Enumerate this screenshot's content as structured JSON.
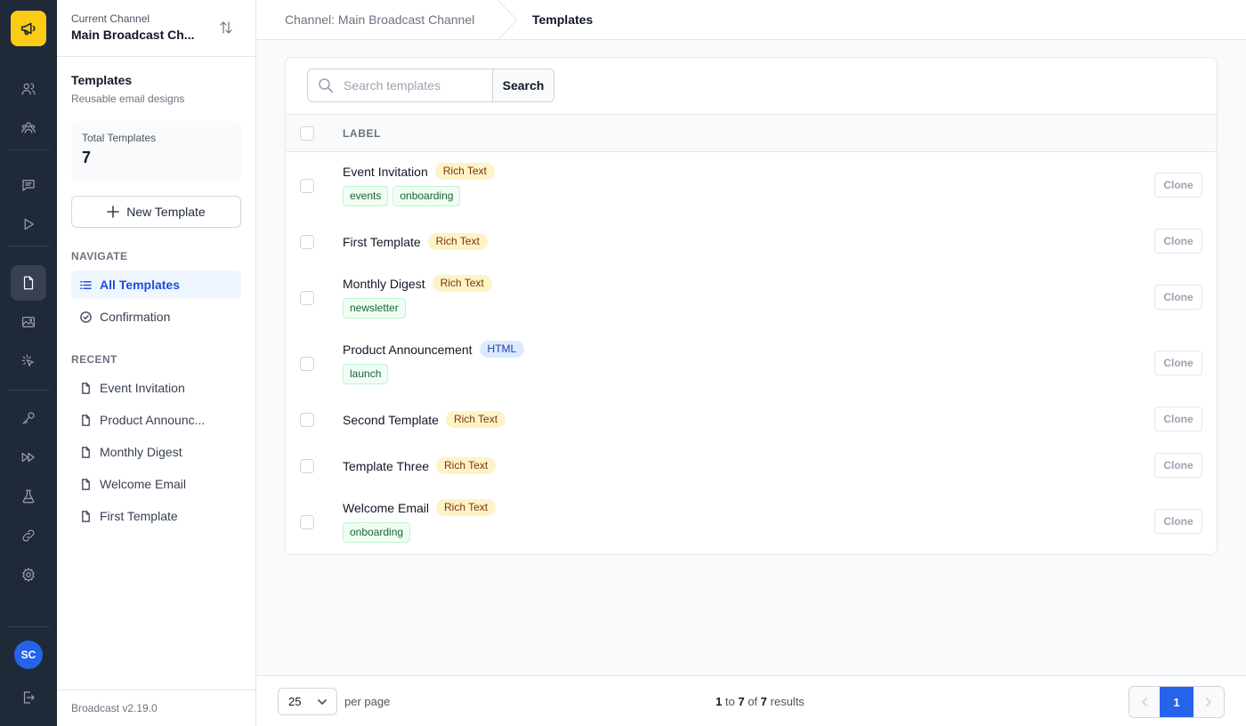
{
  "channel": {
    "label": "Current Channel",
    "name": "Main Broadcast Ch..."
  },
  "sidebar": {
    "title": "Templates",
    "subtitle": "Reusable email designs",
    "stat_label": "Total Templates",
    "stat_value": "7",
    "new_button": "New Template",
    "navigate_heading": "NAVIGATE",
    "nav_items": [
      {
        "label": "All Templates"
      },
      {
        "label": "Confirmation"
      }
    ],
    "recent_heading": "RECENT",
    "recent_items": [
      {
        "label": "Event Invitation"
      },
      {
        "label": "Product Announc..."
      },
      {
        "label": "Monthly Digest"
      },
      {
        "label": "Welcome Email"
      },
      {
        "label": "First Template"
      }
    ],
    "version": "Broadcast v2.19.0"
  },
  "user": {
    "initials": "SC"
  },
  "breadcrumb": {
    "parent": "Channel: Main Broadcast Channel",
    "current": "Templates"
  },
  "search": {
    "placeholder": "Search templates",
    "button": "Search"
  },
  "table": {
    "column_label": "LABEL",
    "clone_label": "Clone",
    "rows": [
      {
        "name": "Event Invitation",
        "type": "Rich Text",
        "tags": [
          "events",
          "onboarding"
        ]
      },
      {
        "name": "First Template",
        "type": "Rich Text",
        "tags": []
      },
      {
        "name": "Monthly Digest",
        "type": "Rich Text",
        "tags": [
          "newsletter"
        ]
      },
      {
        "name": "Product Announcement",
        "type": "HTML",
        "tags": [
          "launch"
        ]
      },
      {
        "name": "Second Template",
        "type": "Rich Text",
        "tags": []
      },
      {
        "name": "Template Three",
        "type": "Rich Text",
        "tags": []
      },
      {
        "name": "Welcome Email",
        "type": "Rich Text",
        "tags": [
          "onboarding"
        ]
      }
    ]
  },
  "pagination": {
    "per_page": "25",
    "per_page_label": "per page",
    "from": "1",
    "to_word": "to",
    "to": "7",
    "of_word": "of",
    "total": "7",
    "results_word": "results",
    "current_page": "1"
  },
  "colors": {
    "accent": "#2563eb",
    "logo": "#facc15",
    "rail": "#1f2937"
  }
}
